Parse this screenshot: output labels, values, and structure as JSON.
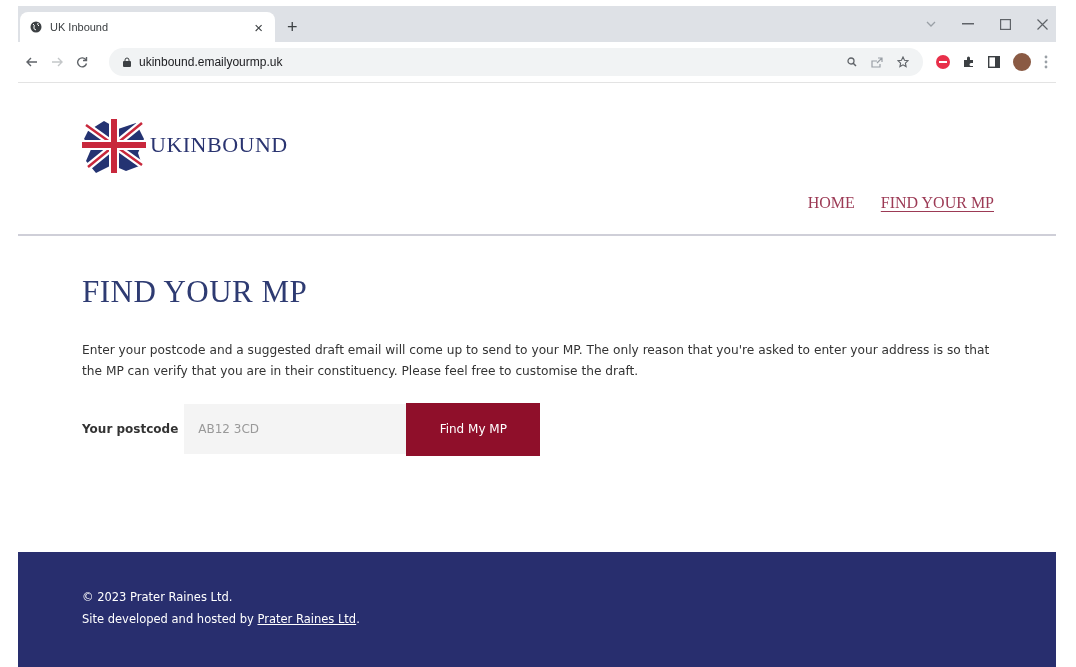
{
  "browser": {
    "tab": {
      "title": "UK Inbound",
      "close": "×"
    },
    "new_tab": "+",
    "url": "ukinbound.emailyourmp.uk"
  },
  "header": {
    "logo": "UKINBOUND",
    "nav": [
      {
        "label": "HOME",
        "selected": false
      },
      {
        "label": "FIND YOUR MP",
        "selected": true
      }
    ]
  },
  "main": {
    "heading": "FIND YOUR MP",
    "intro": "Enter your postcode and a suggested draft email will come up to send to your MP. The only reason that you're asked to enter your address is so that the MP can verify that you are in their constituency. Please feel free to customise the draft.",
    "postcode_label": "Your postcode",
    "postcode_placeholder": "AB12 3CD",
    "button": "Find My MP"
  },
  "footer": {
    "copyright": "© 2023 Prater Raines Ltd.",
    "credit": "Site developed and hosted by ",
    "credit_link": "Prater Raines Ltd",
    "credit_end": "."
  }
}
